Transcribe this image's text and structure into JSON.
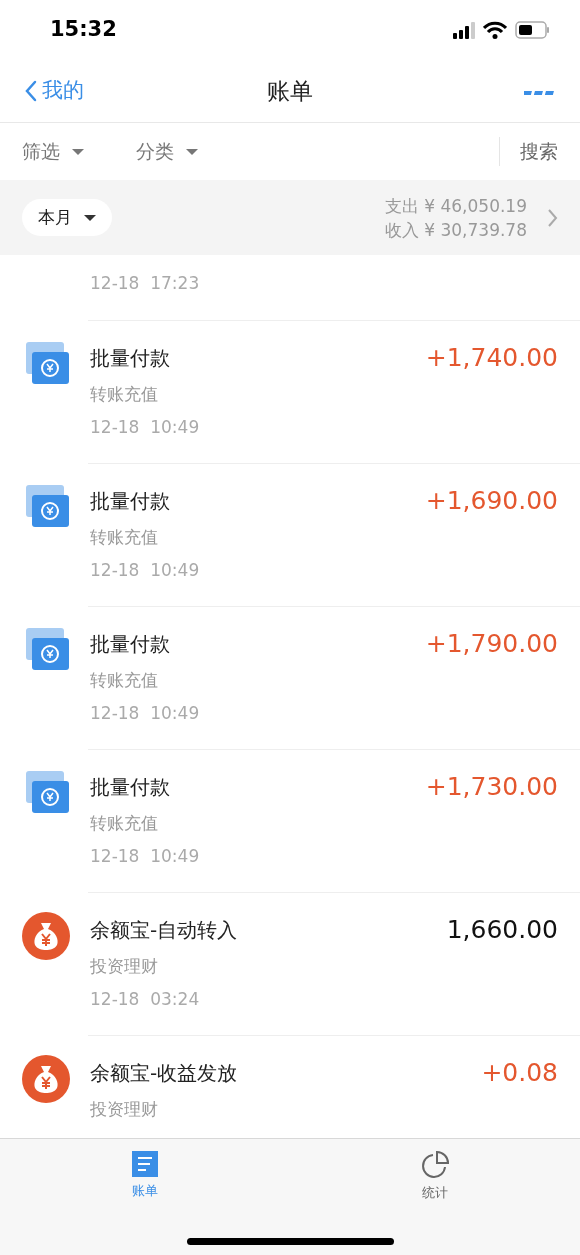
{
  "status_bar": {
    "time": "15:32"
  },
  "nav": {
    "back_label": "我的",
    "title": "账单"
  },
  "filters": [
    {
      "label": "筛选"
    },
    {
      "label": "分类"
    }
  ],
  "search": "搜索",
  "summary": {
    "period": "本月",
    "expense_label": "支出",
    "expense": "¥ 46,050.19",
    "income_label": "收入",
    "income": "¥ 30,739.78"
  },
  "partial_top_row": {
    "time": "12-18  17:23"
  },
  "transactions": [
    {
      "kind": "transfer",
      "title": "批量付款",
      "category": "转账充值",
      "time": "12-18  10:49",
      "amount": "+1,740.00",
      "income": true
    },
    {
      "kind": "transfer",
      "title": "批量付款",
      "category": "转账充值",
      "time": "12-18  10:49",
      "amount": "+1,690.00",
      "income": true
    },
    {
      "kind": "transfer",
      "title": "批量付款",
      "category": "转账充值",
      "time": "12-18  10:49",
      "amount": "+1,790.00",
      "income": true
    },
    {
      "kind": "transfer",
      "title": "批量付款",
      "category": "转账充值",
      "time": "12-18  10:49",
      "amount": "+1,730.00",
      "income": true
    },
    {
      "kind": "fund",
      "title": "余额宝-自动转入",
      "category": "投资理财",
      "time": "12-18  03:24",
      "amount": "1,660.00",
      "income": false
    },
    {
      "kind": "fund",
      "title": "余额宝-收益发放",
      "category": "投资理财",
      "amount": "+0.08",
      "income": true
    }
  ],
  "tab_bar": [
    {
      "kind": "bill",
      "label": "账单",
      "selected": true
    },
    {
      "kind": "stats",
      "label": "统计",
      "selected": false
    }
  ]
}
